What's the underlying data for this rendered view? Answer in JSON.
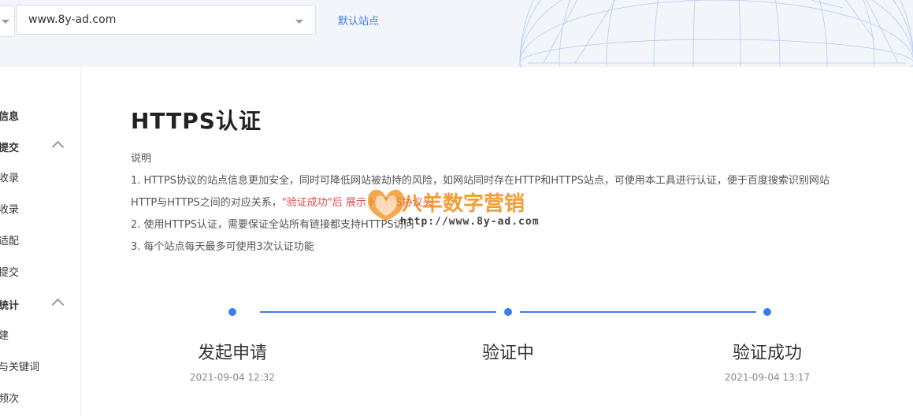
{
  "header": {
    "site_value": "www.8y-ad.com",
    "default_site_label": "默认站点"
  },
  "sidebar": {
    "items": [
      {
        "label": "信息",
        "group": true
      },
      {
        "label": "提交",
        "group": true,
        "expanded": true
      },
      {
        "label": "收录"
      },
      {
        "label": "收录"
      },
      {
        "label": "适配"
      },
      {
        "label": "提交"
      },
      {
        "label": "统计",
        "group": true,
        "expanded": true
      },
      {
        "label": "建"
      },
      {
        "label": "与关键词"
      },
      {
        "label": "频次"
      }
    ]
  },
  "main": {
    "title": "HTTPS认证",
    "desc_heading": "说明",
    "line1": "1. HTTPS协议的站点信息更加安全，同时可降低网站被劫持的风险，如网站同时存在HTTP和HTTPS站点，可使用本工具进行认证，便于百度搜索识别网站",
    "line2_prefix": "HTTP与HTTPS之间的对应关系，",
    "line2_red": "\"验证成功\"后    展示    HTTPS协议头",
    "line3": "2. 使用HTTPS认证，需要保证全站所有链接都支持HTTPS访问",
    "line4": "3. 每个站点每天最多可使用3次认证功能"
  },
  "steps": [
    {
      "title": "发起申请",
      "time": "2021-09-04 12:32"
    },
    {
      "title": "验证中",
      "time": ""
    },
    {
      "title": "验证成功",
      "time": "2021-09-04 13:17"
    }
  ],
  "watermark": {
    "text": "八羊数字营销",
    "url": "http://www.8y-ad.com"
  },
  "colors": {
    "accent": "#3e7df0",
    "warning_text": "#e24b4b",
    "watermark": "#f08c14"
  }
}
